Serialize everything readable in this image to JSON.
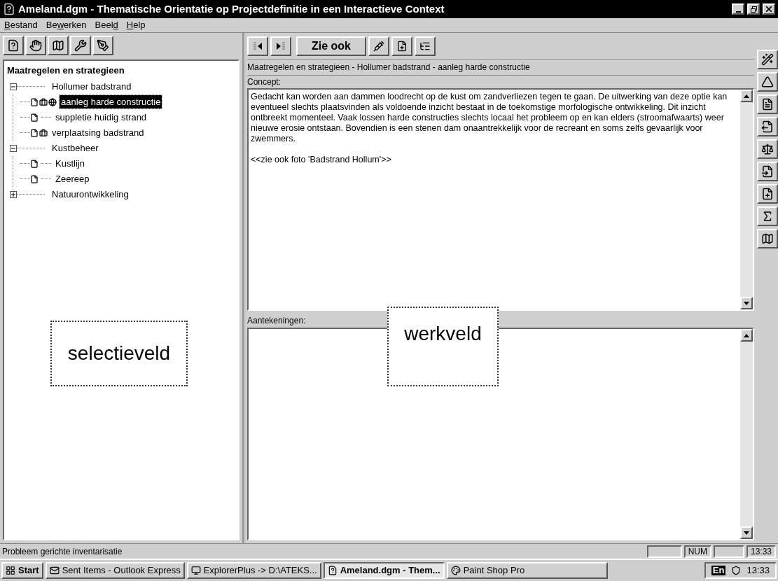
{
  "window": {
    "title": "Ameland.dgm - Thematische Orientatie op Projectdefinitie in een Interactieve Context"
  },
  "menu": [
    {
      "key": "B",
      "after": "estand"
    },
    {
      "before": "Be",
      "key": "w",
      "after": "erken"
    },
    {
      "before": "Beel",
      "key": "d"
    },
    {
      "key": "H",
      "after": "elp"
    }
  ],
  "tree": {
    "title": "Maatregelen en strategieen",
    "items": [
      {
        "label": "Hollumer badstrand",
        "selected": false,
        "expanded": true,
        "children": [
          {
            "label": "aanleg harde constructie",
            "selected": true,
            "icons": [
              {
                "kind": "document"
              },
              {
                "kind": "toolbox"
              },
              {
                "kind": "globe"
              }
            ]
          },
          {
            "label": "suppletie huidig strand",
            "selected": false,
            "icons": [
              {
                "kind": "document"
              }
            ]
          },
          {
            "label": "verplaatsing badstrand",
            "selected": false,
            "icons": [
              {
                "kind": "document"
              },
              {
                "kind": "toolbox"
              }
            ]
          }
        ]
      },
      {
        "label": "Kustbeheer",
        "selected": false,
        "expanded": true,
        "children": [
          {
            "label": "Kustlijn",
            "selected": false,
            "icons": [
              {
                "kind": "document"
              }
            ]
          },
          {
            "label": "Zeereep",
            "selected": false,
            "icons": [
              {
                "kind": "document"
              }
            ]
          }
        ]
      },
      {
        "label": "Natuurontwikkeling",
        "selected": false,
        "expanded": false
      }
    ]
  },
  "annotations": [
    {
      "label": "selectieveld"
    },
    {
      "label": "werkveld"
    }
  ],
  "work_panel": {
    "see_also_button": "Zie ook",
    "breadcrumb": "Maatregelen en strategieen - Hollumer badstrand - aanleg harde constructie",
    "concept": {
      "label": "Concept:",
      "paragraphs": [
        "Gedacht kan worden aan dammen loodrecht op de kust om zandverliezen tegen te gaan. De uitwerking van deze optie kan eventueel slechts plaatsvinden als voldoende inzicht bestaat in de toekomstige morfologische ontwikkeling. Dit inzicht ontbreekt momenteel. Vaak lossen harde constructies slechts locaal het probleem op en kan elders (stroomafwaarts) weer nieuwe erosie ontstaan. Bovendien is een stenen dam onaantrekkelijk voor de recreant en soms zelfs gevaarlijk voor zwemmers.",
        "<<zie ook foto 'Badstrand Hollum'>>"
      ]
    },
    "notes": {
      "label": "Aantekeningen:"
    }
  },
  "status_bar": {
    "message": "Probleem gerichte inventarisatie",
    "indicator": "NUM",
    "clock": "13:33"
  },
  "taskbar": {
    "start": "Start",
    "tasks": [
      {
        "label": "Sent Items - Outlook Express",
        "selected": false
      },
      {
        "label": "ExplorerPlus -> D:\\ATEKS...",
        "selected": false
      },
      {
        "label": "Ameland.dgm - Them...",
        "selected": true
      },
      {
        "label": "Paint Shop Pro",
        "selected": false
      }
    ],
    "tray": {
      "language": "En",
      "clock": "13:33"
    }
  }
}
